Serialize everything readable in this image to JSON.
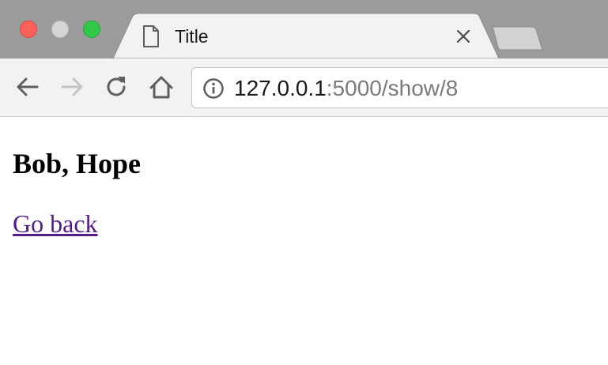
{
  "browser": {
    "tab": {
      "title": "Title",
      "icon": "document-icon",
      "close_icon": "close-icon"
    },
    "new_tab_icon": "new-tab-icon",
    "toolbar": {
      "back_icon": "back-arrow-icon",
      "forward_icon": "forward-arrow-icon",
      "reload_icon": "reload-icon",
      "home_icon": "home-icon"
    },
    "address_bar": {
      "security_icon": "info-icon",
      "host": "127.0.0.1",
      "rest": ":5000/show/8"
    },
    "colors": {
      "close": "#fc605b",
      "minimize": "#d6d6d6",
      "maximize": "#34c84a",
      "visited_link": "#551a8b"
    }
  },
  "page": {
    "heading": "Bob, Hope",
    "link_label": "Go back"
  }
}
